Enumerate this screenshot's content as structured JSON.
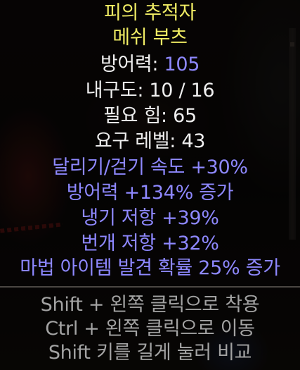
{
  "item": {
    "name": "피의 추적자",
    "base_type": "메쉬 부츠",
    "defense_label": "방어력:",
    "defense_value": "105",
    "durability": "내구도: 10 / 16",
    "required_strength": "필요 힘: 65",
    "required_level": "요구 레벨: 43",
    "magic_properties": [
      "달리기/걷기 속도 +30%",
      "방어력 +134% 증가",
      "냉기 저항 +39%",
      "번개 저항 +32%",
      "마법 아이템 발견 확률 25% 증가"
    ]
  },
  "hints": [
    "Shift + 왼쪽 클릭으로 착용",
    "Ctrl + 왼쪽 클릭으로 이동",
    "Shift 키를 길게 눌러 비교"
  ],
  "colors": {
    "unique_name": "#f0ec64",
    "stat_white": "#efefef",
    "magic_blue": "#8e88ff",
    "hint_grey": "#a3a3a3"
  }
}
